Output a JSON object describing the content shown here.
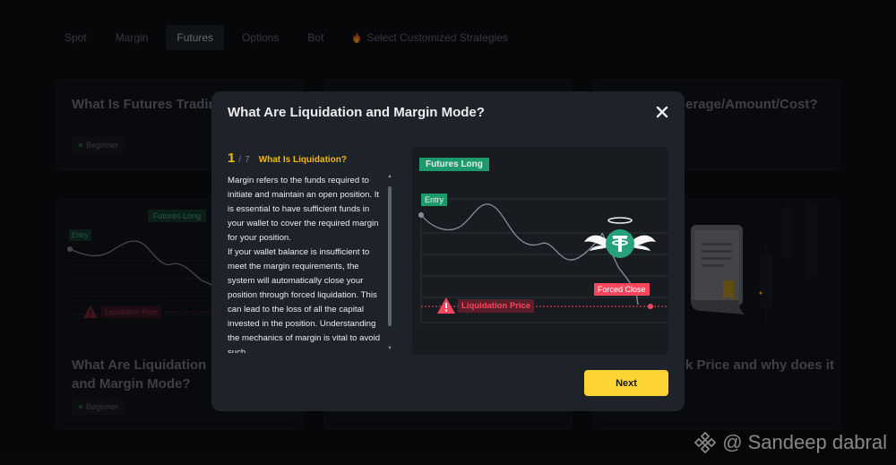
{
  "tabs": [
    {
      "label": "Spot",
      "active": false
    },
    {
      "label": "Margin",
      "active": false
    },
    {
      "label": "Futures",
      "active": true
    },
    {
      "label": "Options",
      "active": false
    },
    {
      "label": "Bot",
      "active": false
    },
    {
      "label": "Select Customized Strategies",
      "active": false,
      "icon": "flame-icon"
    }
  ],
  "cards": {
    "futures_trading_title": "What Is Futures Trading",
    "futures_trading_badge": "Beginner",
    "leverage_title": "erage/Amount/Cost?",
    "liquidation_title": "What Are Liquidation and Margin Mode?",
    "liquidation_badge": "Beginner",
    "mark_price_title": "k Price and why does it",
    "chart_futures_long": "Futures Long",
    "chart_entry": "Entry",
    "chart_liq_price": "Liquidation Price"
  },
  "modal": {
    "title": "What Are Liquidation and Margin Mode?",
    "step_current": "1",
    "step_total": "7",
    "step_title": "What Is Liquidation?",
    "paragraph_1": "Margin refers to the funds required to initiate and maintain an open position. It is essential to have sufficient funds in your wallet to cover the required margin for your position.",
    "paragraph_2": "If your wallet balance is insufficient to meet the margin requirements, the system will automatically close your position through forced liquidation. This can lead to the loss of all the capital invested in the position. Understanding the mechanics of margin is vital to avoid such",
    "next_label": "Next",
    "illustration": {
      "futures_long": "Futures Long",
      "entry": "Entry",
      "forced_close": "Forced Close",
      "liquidation_price": "Liquidation Price"
    }
  },
  "watermark": "@ Sandeep dabral",
  "colors": {
    "accent": "#fcd535",
    "yellow_text": "#f0b90b",
    "green_label": "#1c9a6c",
    "red_label": "#f6465d",
    "tether_green": "#26a17b"
  }
}
